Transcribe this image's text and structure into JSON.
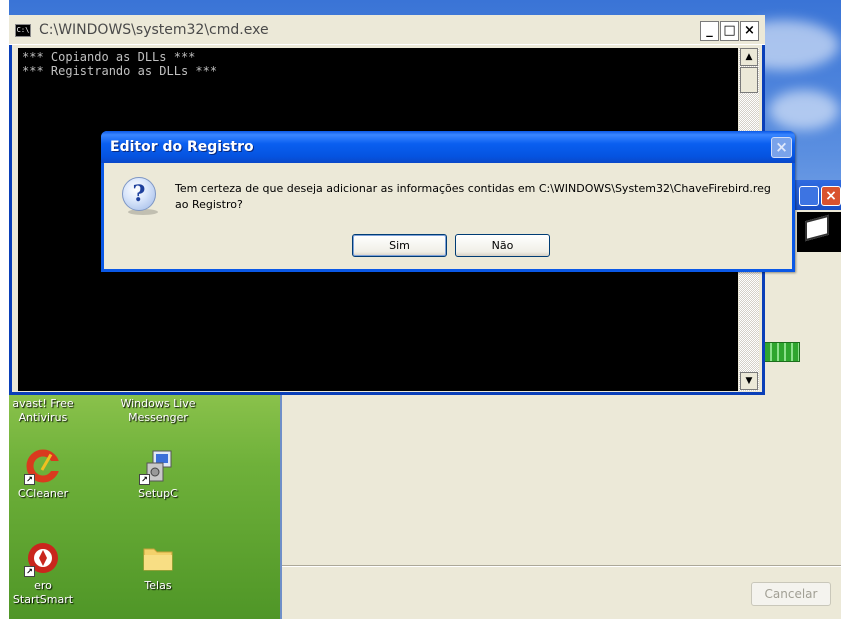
{
  "cmd_window": {
    "title": "C:\\WINDOWS\\system32\\cmd.exe",
    "icon": "C:\\",
    "buttons": {
      "minimize": "_",
      "maximize": "□",
      "close": "×"
    },
    "output_lines": [
      "*** Copiando as DLLs ***",
      "*** Registrando as DLLs ***"
    ],
    "scroll_up": "▲",
    "scroll_down": "▼"
  },
  "dialog": {
    "title": "Editor do Registro",
    "close": "×",
    "icon": "question-icon",
    "icon_glyph": "?",
    "message": "Tem certeza de que deseja adicionar as informações contidas em C:\\WINDOWS\\System32\\ChaveFirebird.reg ao Registro?",
    "yes_label": "Sim",
    "no_label": "Não"
  },
  "background_window": {
    "close": "×",
    "cancel_label": "Cancelar"
  },
  "desktop_icons": [
    {
      "label": "avast! Free Antivirus",
      "icon": "avast-icon"
    },
    {
      "label": "Windows Live Messenger",
      "icon": "messenger-icon"
    },
    {
      "label": "CCleaner",
      "icon": "ccleaner-icon"
    },
    {
      "label": "SetupC",
      "icon": "setup-icon"
    },
    {
      "label": "ero StartSmart",
      "icon": "startsmart-icon"
    },
    {
      "label": "Telas",
      "icon": "folder-icon"
    }
  ],
  "colors": {
    "xp_title_blue": "#0a58e6",
    "console_bg": "#000000",
    "dialog_bg": "#ece9d8"
  }
}
